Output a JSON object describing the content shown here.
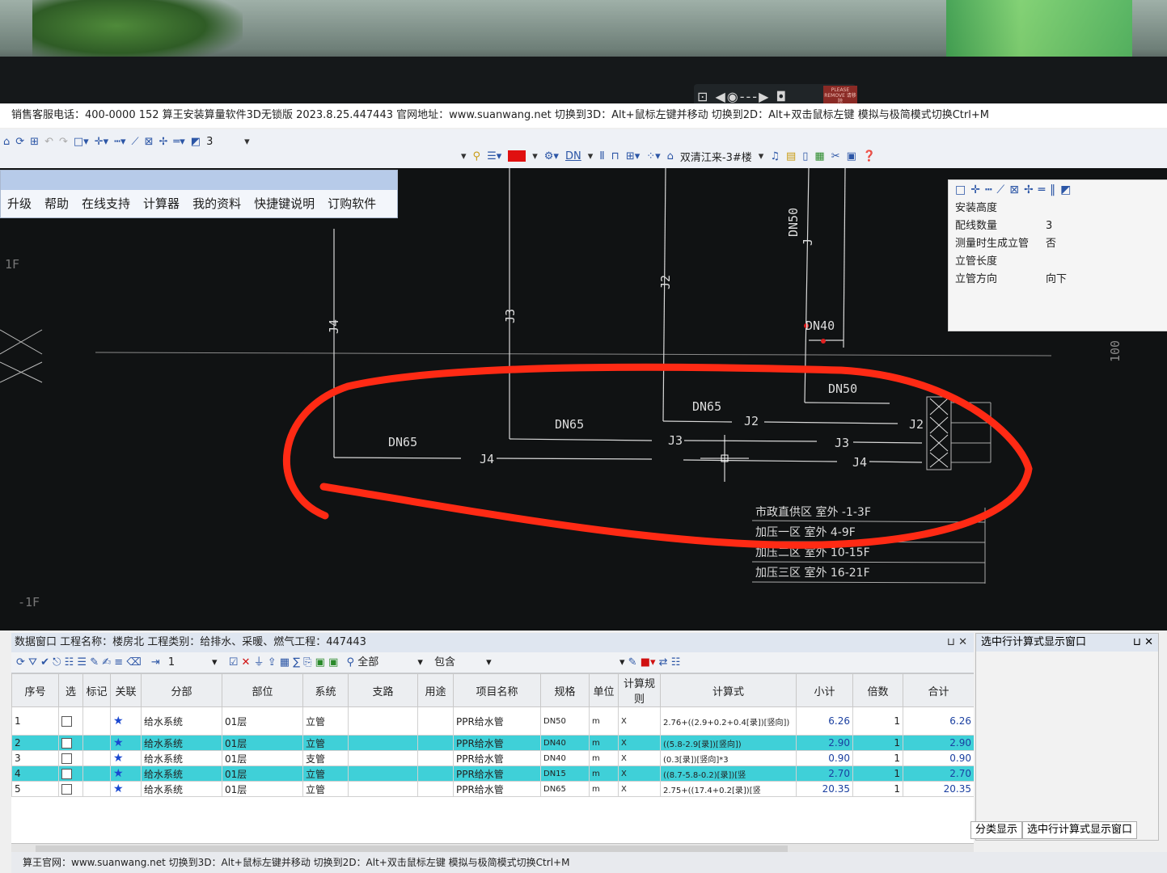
{
  "window": {
    "title": "销售客服电话：400-0000 152   算王安装算量软件3D无锁版 2023.8.25.447443 官网地址：www.suanwang.net   切换到3D：Alt+鼠标左键并移动 切换到2D：Alt+双击鼠标左键 模拟与极简模式切换Ctrl+M"
  },
  "camera": {
    "label": "PLEASE REMOVE 请移除"
  },
  "toolbar": {
    "row1_icons": [
      "home-icon",
      "refresh-icon",
      "zoom-extents-icon",
      "undo-icon",
      "redo-icon",
      "rectangle-icon",
      "crosshair-icon",
      "dashed-line-icon",
      "polyline-icon",
      "cross-delete-icon",
      "snap-icon",
      "double-line-icon",
      "frame-icon"
    ],
    "row1_value": "3",
    "row2_items": [
      "DN",
      "双清江来-3#楼"
    ],
    "color": "#e01010"
  },
  "menu": {
    "items": [
      "升级",
      "帮助",
      "在线支持",
      "计算器",
      "我的资料",
      "快捷键说明",
      "订购软件"
    ]
  },
  "properties": {
    "rows": [
      {
        "key": "安装高度",
        "value": ""
      },
      {
        "key": "配线数量",
        "value": "3"
      },
      {
        "key": "测量时生成立管",
        "value": "否"
      },
      {
        "key": "立管长度",
        "value": ""
      },
      {
        "key": "立管方向",
        "value": "向下"
      }
    ]
  },
  "drawing": {
    "labels": [
      "J4",
      "J3",
      "J2",
      "J",
      "DN50",
      "DN40",
      "DN50",
      "DN65",
      "DN65",
      "DN65",
      "J2",
      "J3",
      "J4",
      "J3",
      "J4",
      "J2",
      "1F",
      "-1F",
      "100"
    ],
    "legend": [
      "市政直供区  室外  -1-3F",
      "加压一区  室外  4-9F",
      "加压二区  室外  10-15F",
      "加压三区  室外  16-21F"
    ],
    "annotation_color": "#ff2a14"
  },
  "data_window": {
    "title": "数据窗口  工程名称：楼房北  工程类别：给排水、采暖、燃气工程：447443",
    "pin": "⊔ ✕",
    "filter_all": "全部",
    "filter_contains": "包含",
    "page_value": "1",
    "columns": [
      "序号",
      "选",
      "标记",
      "关联",
      "分部",
      "部位",
      "系统",
      "支路",
      "用途",
      "项目名称",
      "规格",
      "单位",
      "计算规则",
      "计算式",
      "小计",
      "倍数",
      "合计"
    ],
    "rows": [
      {
        "no": "1",
        "part": "给水系统",
        "loc": "01层",
        "sys": "立管",
        "branch": "",
        "use": "",
        "item": "PPR给水管",
        "spec": "DN50",
        "unit": "m",
        "rule": "X",
        "formula": "2.76+((2.9+0.2+0.4[录])[竖向])",
        "subtotal": "6.26",
        "mult": "1",
        "total": "6.26",
        "selected": false
      },
      {
        "no": "2",
        "part": "给水系统",
        "loc": "01层",
        "sys": "立管",
        "branch": "",
        "use": "",
        "item": "PPR给水管",
        "spec": "DN40",
        "unit": "m",
        "rule": "X",
        "formula": "((5.8-2.9[录])[竖向])",
        "subtotal": "2.90",
        "mult": "1",
        "total": "2.90",
        "selected": true
      },
      {
        "no": "3",
        "part": "给水系统",
        "loc": "01层",
        "sys": "支管",
        "branch": "",
        "use": "",
        "item": "PPR给水管",
        "spec": "DN40",
        "unit": "m",
        "rule": "X",
        "formula": "(0.3[录])[竖向]*3",
        "subtotal": "0.90",
        "mult": "1",
        "total": "0.90",
        "selected": false
      },
      {
        "no": "4",
        "part": "给水系统",
        "loc": "01层",
        "sys": "立管",
        "branch": "",
        "use": "",
        "item": "PPR给水管",
        "spec": "DN15",
        "unit": "m",
        "rule": "X",
        "formula": "((8.7-5.8-0.2)[录])[竖",
        "subtotal": "2.70",
        "mult": "1",
        "total": "2.70",
        "selected": true
      },
      {
        "no": "5",
        "part": "给水系统",
        "loc": "01层",
        "sys": "立管",
        "branch": "",
        "use": "",
        "item": "PPR给水管",
        "spec": "DN65",
        "unit": "m",
        "rule": "X",
        "formula": "2.75+((17.4+0.2[录])[竖",
        "subtotal": "20.35",
        "mult": "1",
        "total": "20.35",
        "selected": false
      }
    ]
  },
  "side_panel": {
    "title": "选中行计算式显示窗口",
    "pin": "⊔ ✕",
    "tab1": "分类显示",
    "tab2": "选中行计算式显示窗口"
  },
  "status": {
    "text": "算王官网：www.suanwang.net  切换到3D：Alt+鼠标左键并移动 切换到2D：Alt+双击鼠标左键 模拟与极简模式切换Ctrl+M"
  }
}
